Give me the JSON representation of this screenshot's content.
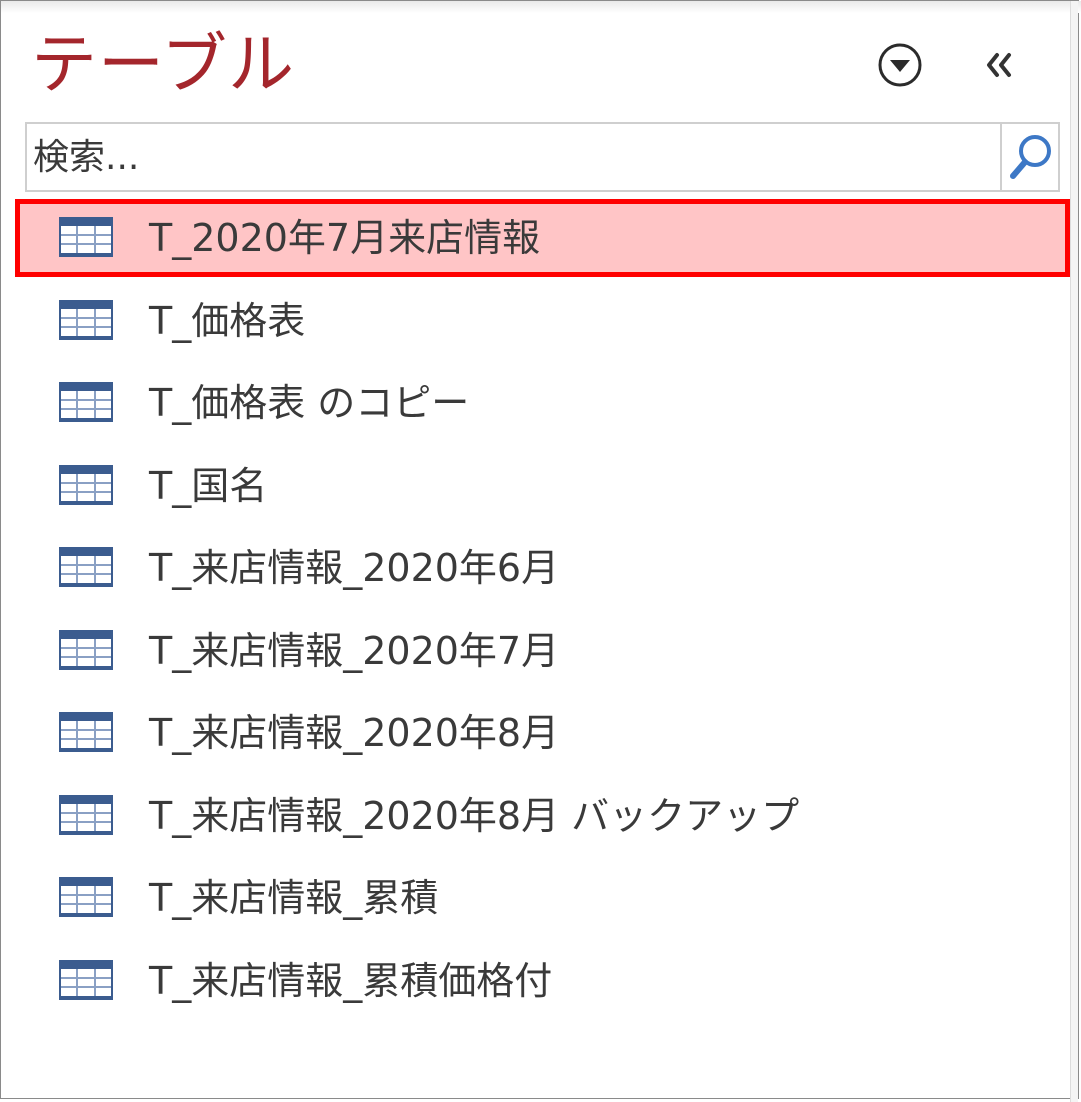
{
  "header": {
    "title": "テーブル",
    "menu_icon": "dropdown-circle-icon",
    "collapse_icon": "double-chevron-left-icon"
  },
  "search": {
    "placeholder": "検索...",
    "value": "",
    "icon": "search-icon"
  },
  "tables": {
    "icon": "table-icon",
    "selected_index": 0,
    "selection_color": "#ffc5c6",
    "highlight_border_color": "#ff0000",
    "items": [
      {
        "label": "T_2020年7月来店情報"
      },
      {
        "label": "T_価格表"
      },
      {
        "label": "T_価格表 のコピー"
      },
      {
        "label": "T_国名"
      },
      {
        "label": "T_来店情報_2020年6月"
      },
      {
        "label": "T_来店情報_2020年7月"
      },
      {
        "label": "T_来店情報_2020年8月"
      },
      {
        "label": "T_来店情報_2020年8月 バックアップ"
      },
      {
        "label": "T_来店情報_累積"
      },
      {
        "label": "T_来店情報_累積価格付"
      }
    ]
  },
  "colors": {
    "title": "#a4262c",
    "text": "#3a3a3a",
    "icon_blue": "#3b5c8f"
  }
}
